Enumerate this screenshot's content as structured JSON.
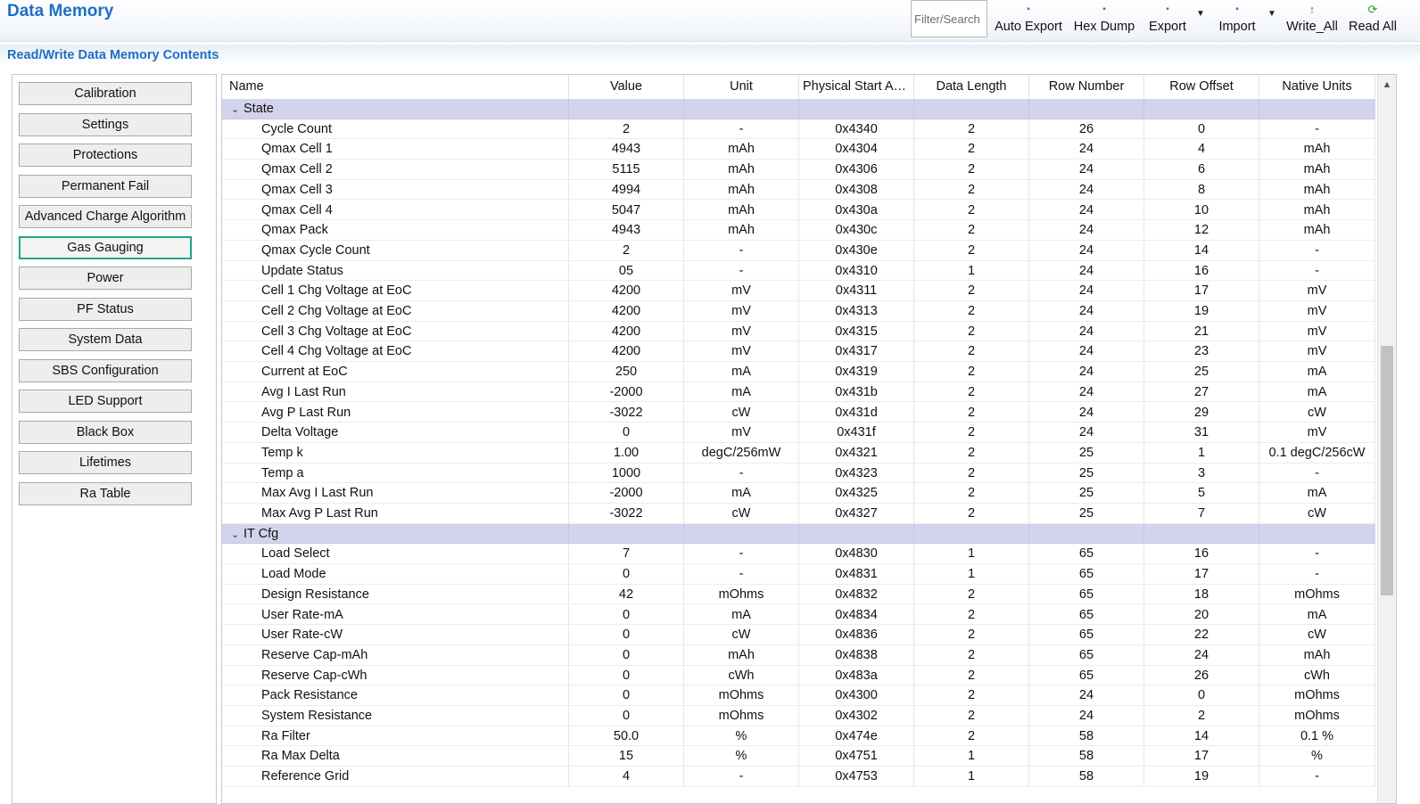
{
  "app": {
    "title": "Data Memory",
    "subtitle": "Read/Write Data Memory Contents"
  },
  "toolbar": {
    "filter_placeholder": "Filter/Search",
    "buttons": [
      {
        "label": "Auto Export",
        "icon": "export-small-icon"
      },
      {
        "label": "Hex Dump",
        "icon": "hexdump-small-icon"
      },
      {
        "label": "Export",
        "icon": "export-small-icon"
      },
      {
        "label": "Import",
        "icon": "import-small-icon"
      },
      {
        "label": "Write_All",
        "icon": "arrow-up-green-icon"
      },
      {
        "label": "Read All",
        "icon": "refresh-green-icon"
      }
    ]
  },
  "sidebar": {
    "active_index": 5,
    "items": [
      "Calibration",
      "Settings",
      "Protections",
      "Permanent Fail",
      "Advanced Charge Algorithm",
      "Gas Gauging",
      "Power",
      "PF Status",
      "System Data",
      "SBS Configuration",
      "LED Support",
      "Black Box",
      "Lifetimes",
      "Ra Table"
    ]
  },
  "grid": {
    "columns": [
      "Name",
      "Value",
      "Unit",
      "Physical Start Ad...",
      "Data Length",
      "Row Number",
      "Row Offset",
      "Native Units"
    ],
    "groups": [
      {
        "name": "State",
        "rows": [
          [
            "Cycle Count",
            "2",
            "-",
            "0x4340",
            "2",
            "26",
            "0",
            "-"
          ],
          [
            "Qmax Cell 1",
            "4943",
            "mAh",
            "0x4304",
            "2",
            "24",
            "4",
            "mAh"
          ],
          [
            "Qmax Cell 2",
            "5115",
            "mAh",
            "0x4306",
            "2",
            "24",
            "6",
            "mAh"
          ],
          [
            "Qmax Cell 3",
            "4994",
            "mAh",
            "0x4308",
            "2",
            "24",
            "8",
            "mAh"
          ],
          [
            "Qmax Cell 4",
            "5047",
            "mAh",
            "0x430a",
            "2",
            "24",
            "10",
            "mAh"
          ],
          [
            "Qmax Pack",
            "4943",
            "mAh",
            "0x430c",
            "2",
            "24",
            "12",
            "mAh"
          ],
          [
            "Qmax Cycle Count",
            "2",
            "-",
            "0x430e",
            "2",
            "24",
            "14",
            "-"
          ],
          [
            "Update Status",
            "05",
            "-",
            "0x4310",
            "1",
            "24",
            "16",
            "-"
          ],
          [
            "Cell 1 Chg Voltage at EoC",
            "4200",
            "mV",
            "0x4311",
            "2",
            "24",
            "17",
            "mV"
          ],
          [
            "Cell 2 Chg Voltage at EoC",
            "4200",
            "mV",
            "0x4313",
            "2",
            "24",
            "19",
            "mV"
          ],
          [
            "Cell 3 Chg Voltage at EoC",
            "4200",
            "mV",
            "0x4315",
            "2",
            "24",
            "21",
            "mV"
          ],
          [
            "Cell 4 Chg Voltage at EoC",
            "4200",
            "mV",
            "0x4317",
            "2",
            "24",
            "23",
            "mV"
          ],
          [
            "Current at EoC",
            "250",
            "mA",
            "0x4319",
            "2",
            "24",
            "25",
            "mA"
          ],
          [
            "Avg I Last Run",
            "-2000",
            "mA",
            "0x431b",
            "2",
            "24",
            "27",
            "mA"
          ],
          [
            "Avg P Last Run",
            "-3022",
            "cW",
            "0x431d",
            "2",
            "24",
            "29",
            "cW"
          ],
          [
            "Delta Voltage",
            "0",
            "mV",
            "0x431f",
            "2",
            "24",
            "31",
            "mV"
          ],
          [
            "Temp k",
            "1.00",
            "degC/256mW",
            "0x4321",
            "2",
            "25",
            "1",
            "0.1 degC/256cW"
          ],
          [
            "Temp a",
            "1000",
            "-",
            "0x4323",
            "2",
            "25",
            "3",
            "-"
          ],
          [
            "Max Avg I Last Run",
            "-2000",
            "mA",
            "0x4325",
            "2",
            "25",
            "5",
            "mA"
          ],
          [
            "Max Avg P Last Run",
            "-3022",
            "cW",
            "0x4327",
            "2",
            "25",
            "7",
            "cW"
          ]
        ]
      },
      {
        "name": "IT Cfg",
        "rows": [
          [
            "Load Select",
            "7",
            "-",
            "0x4830",
            "1",
            "65",
            "16",
            "-"
          ],
          [
            "Load Mode",
            "0",
            "-",
            "0x4831",
            "1",
            "65",
            "17",
            "-"
          ],
          [
            "Design Resistance",
            "42",
            "mOhms",
            "0x4832",
            "2",
            "65",
            "18",
            "mOhms"
          ],
          [
            "User Rate-mA",
            "0",
            "mA",
            "0x4834",
            "2",
            "65",
            "20",
            "mA"
          ],
          [
            "User Rate-cW",
            "0",
            "cW",
            "0x4836",
            "2",
            "65",
            "22",
            "cW"
          ],
          [
            "Reserve Cap-mAh",
            "0",
            "mAh",
            "0x4838",
            "2",
            "65",
            "24",
            "mAh"
          ],
          [
            "Reserve Cap-cWh",
            "0",
            "cWh",
            "0x483a",
            "2",
            "65",
            "26",
            "cWh"
          ],
          [
            "Pack Resistance",
            "0",
            "mOhms",
            "0x4300",
            "2",
            "24",
            "0",
            "mOhms"
          ],
          [
            "System Resistance",
            "0",
            "mOhms",
            "0x4302",
            "2",
            "24",
            "2",
            "mOhms"
          ],
          [
            "Ra Filter",
            "50.0",
            "%",
            "0x474e",
            "2",
            "58",
            "14",
            "0.1 %"
          ],
          [
            "Ra Max Delta",
            "15",
            "%",
            "0x4751",
            "1",
            "58",
            "17",
            "%"
          ],
          [
            "Reference Grid",
            "4",
            "-",
            "0x4753",
            "1",
            "58",
            "19",
            "-"
          ]
        ]
      }
    ]
  }
}
